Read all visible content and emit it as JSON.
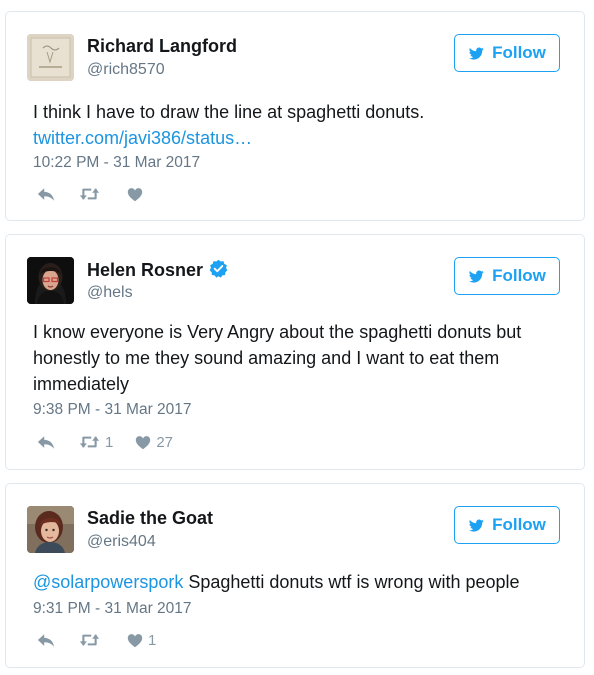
{
  "follow_label": "Follow",
  "tweets": [
    {
      "name": "Richard Langford",
      "handle": "@rich8570",
      "text": "I think I have to draw the line at spaghetti donuts.",
      "link": "twitter.com/javi386/status…",
      "time": "10:22 PM - 31 Mar 2017",
      "retweets": "",
      "likes": ""
    },
    {
      "name": "Helen Rosner",
      "handle": "@hels",
      "verified": true,
      "text_lines": [
        "I know everyone is Very Angry about the spaghetti donuts but",
        "honestly to me they sound amazing and I want to eat them",
        "immediately"
      ],
      "time": "9:38 PM - 31 Mar 2017",
      "retweets": "1",
      "likes": "27"
    },
    {
      "name": "Sadie the Goat",
      "handle": "@eris404",
      "mention": "@solarpowerspork",
      "text": " Spaghetti donuts wtf is wrong with people",
      "time": "9:31 PM - 31 Mar 2017",
      "retweets": "",
      "likes": "1"
    }
  ],
  "icons": {
    "reply": "reply-icon",
    "retweet": "retweet-icon",
    "like": "heart-icon",
    "bird": "twitter-bird-icon",
    "verified": "verified-badge-icon"
  },
  "colors": {
    "accent": "#1da1f2",
    "link": "#1b95e0",
    "muted": "#657786",
    "icon": "#8899a6",
    "border": "#e1e8ed"
  }
}
